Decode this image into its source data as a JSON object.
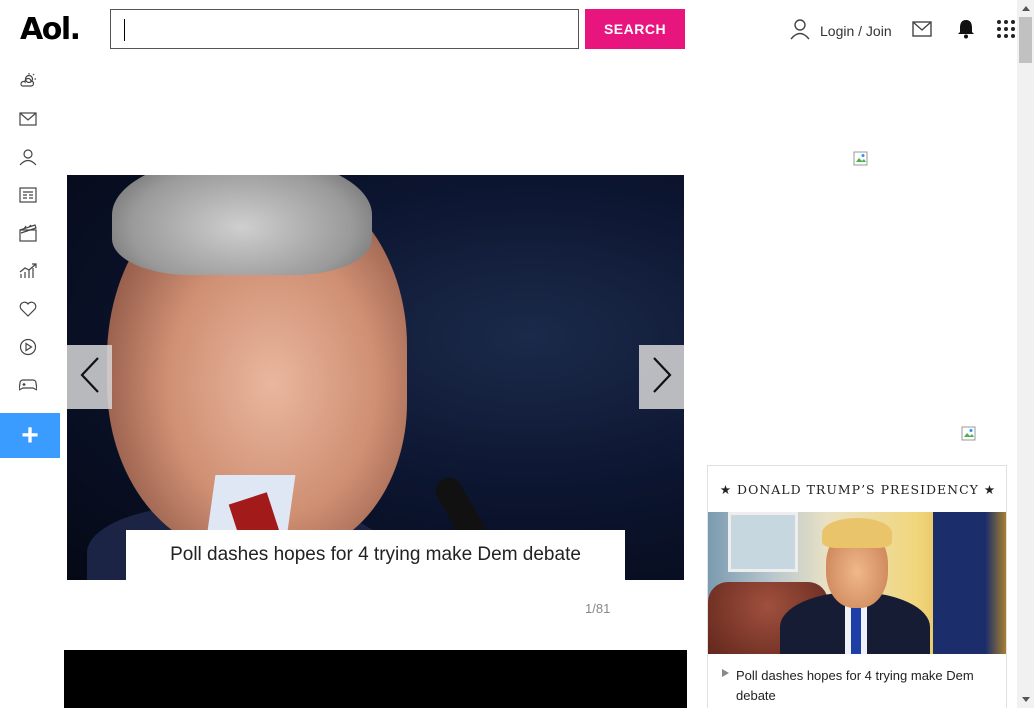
{
  "header": {
    "logo": "Aol.",
    "search_placeholder": "",
    "search_button": "SEARCH",
    "login_label": "Login / Join"
  },
  "leftnav": {
    "items": [
      "weather-icon",
      "mail-icon",
      "profile-icon",
      "news-icon",
      "entertainment-icon",
      "finance-icon",
      "lifestyle-icon",
      "video-icon",
      "games-icon"
    ],
    "add_label": "+"
  },
  "slideshow": {
    "caption": "Poll dashes hopes for 4 trying make Dem debate",
    "counter": "1/81"
  },
  "sidebar_card": {
    "title": "★ DONALD TRUMP’S PRESIDENCY ★",
    "headline": "Poll dashes hopes for 4 trying make Dem debate"
  },
  "colors": {
    "search_button": "#e8157f",
    "add_button": "#3b9cff"
  }
}
